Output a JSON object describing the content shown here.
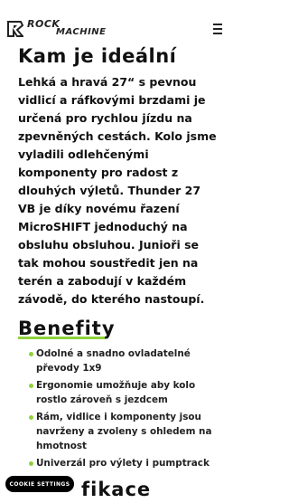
{
  "brand": {
    "name_line1": "ROCK",
    "name_line2": "MACHINE",
    "accent": "#8fd13c"
  },
  "menu": {
    "icon": "hamburger-menu-icon"
  },
  "intro": {
    "heading": "Kam je ideální",
    "text": "Lehká a hravá 27“ s pevnou vidlicí a ráfkovými brzdami je určená pro rychlou jízdu na zpevněných cestách. Kolo jsme vyladili odlehčenými komponenty pro radost z dlouhých výletů. Thunder 27 VB je díky novému řazení MicroSHIFT jednoduchý na obsluhu obsluhou. Junioři se tak mohou soustředit jen na terén a zabodují v každém závodě, do kterého nastoupí."
  },
  "benefits": {
    "heading": "Benefity",
    "items": [
      "Odolné a snadno ovladatelné převody 1x9",
      "Ergonomie umožňuje aby kolo rostlo zároveň s jezdcem",
      "Rám, vidlice i komponenty jsou navrženy a zvoleny s ohledem na hmotnost",
      "Univerzál pro výlety i pumptrack"
    ]
  },
  "next_section": {
    "heading_partial": "fikace"
  },
  "cookie": {
    "label": "COOKIE SETTINGS"
  }
}
